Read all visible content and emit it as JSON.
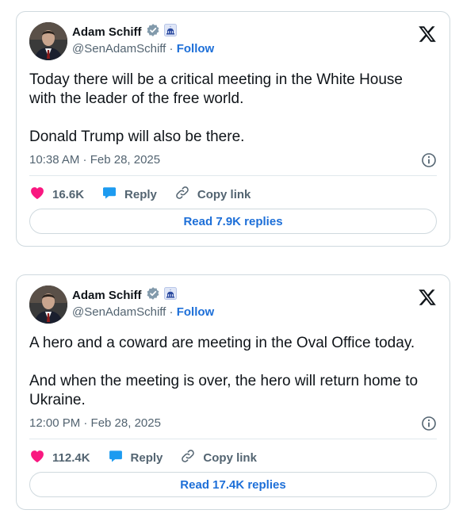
{
  "tweets": [
    {
      "author": {
        "name": "Adam Schiff",
        "handle": "@SenAdamSchiff",
        "follow_label": "Follow"
      },
      "text": "Today there will be a critical meeting in the White House with the leader of the free world.\n\nDonald Trump will also be there.",
      "timestamp": "10:38 AM · Feb 28, 2025",
      "likes": "16.6K",
      "reply_label": "Reply",
      "copy_link_label": "Copy link",
      "read_replies_label": "Read 7.9K replies"
    },
    {
      "author": {
        "name": "Adam Schiff",
        "handle": "@SenAdamSchiff",
        "follow_label": "Follow"
      },
      "text": "A hero and a coward are meeting in the Oval Office today.\n\nAnd when the meeting is over, the hero will return home to Ukraine.",
      "timestamp": "12:00 PM · Feb 28, 2025",
      "likes": "112.4K",
      "reply_label": "Reply",
      "copy_link_label": "Copy link",
      "read_replies_label": "Read 17.4K replies"
    }
  ],
  "icons": {
    "verified": "verified-badge-icon",
    "affiliation": "us-senate-capitol-icon",
    "brand": "x-logo-icon",
    "info": "info-icon",
    "like": "heart-icon",
    "reply": "speech-bubble-icon",
    "copy": "link-chain-icon"
  },
  "colors": {
    "accent": "#1d6fd8",
    "like": "#f91880",
    "reply": "#1d9bf0",
    "muted": "#536471"
  }
}
